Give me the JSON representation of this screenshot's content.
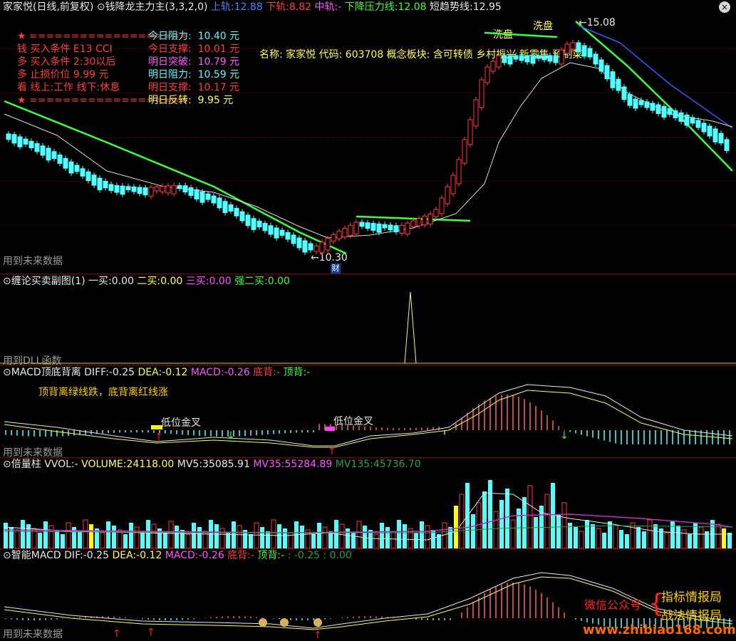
{
  "title_bar": {
    "stock": "家家悦",
    "period": "(日线,前复权)",
    "indicator_icon": "chevron-circle-icon",
    "indicator": "钱降龙主力主(3,3,2,0)",
    "up_track_label": "上轨:",
    "up_track_value": "12.88",
    "down_track_label": "下轨:",
    "down_track_value": "8.82",
    "mid_track_label": "中轨:",
    "mid_track_value": "-",
    "pressure_label": "下降压力线:",
    "pressure_value": "12.08",
    "short_trend_label": "短趋势线:",
    "short_trend_value": "12.95",
    "close_icon": "x-circle-icon",
    "close_glyph": "×"
  },
  "info_left": [
    {
      "star": "★",
      "text": "===================",
      "color": "#ff3c3c"
    },
    {
      "char": "钱",
      "text": "买入条件 E13 CCI",
      "color": "#ff3c3c"
    },
    {
      "char": "多",
      "text": "买入条件 2:30以后",
      "color": "#ff3c3c"
    },
    {
      "char": "多",
      "text": "止损价位 9.99 元",
      "color": "#ff3c3c"
    },
    {
      "char": "看",
      "text": "线上:工作 线下:休息",
      "color": "#ff3c3c"
    },
    {
      "star": "★",
      "text": "===================",
      "color": "#ff3c3c"
    }
  ],
  "info_right": [
    {
      "label": "今日阻力:",
      "value": "10.40 元",
      "label_color": "#54ffff",
      "value_color": "#54ffff"
    },
    {
      "label": "今日支撑:",
      "value": "10.01 元",
      "label_color": "#ff3c3c",
      "value_color": "#ff3c3c"
    },
    {
      "label": "明日突破:",
      "value": "10.79 元",
      "label_color": "#ff54ff",
      "value_color": "#ff54ff"
    },
    {
      "label": "明日阻力:",
      "value": "10.59 元",
      "label_color": "#54ffff",
      "value_color": "#54ffff"
    },
    {
      "label": "明日支撑:",
      "value": "10.17 元",
      "label_color": "#ff3c3c",
      "value_color": "#ff3c3c"
    },
    {
      "label": "明日反转:",
      "value": "9.95 元",
      "label_color": "#ffff54",
      "value_color": "#ffff54"
    }
  ],
  "stock_info": "名称: 家家悦 代码: 603708 概念板块: 含可转债 乡村振兴 新零售 预制菜",
  "price_annotations": {
    "wash1": "洗盘",
    "wash2": "洗盘",
    "high": "15.08",
    "low": "10.30",
    "cai_badge": "财",
    "future_data_1": "用到未来数据"
  },
  "panel2": {
    "icon": "chevron-circle-icon",
    "title": "缠论买卖副图(1)",
    "buy1_label": "一买:",
    "buy1_value": "0.00",
    "buy2_label": "二买:",
    "buy2_value": "0.00",
    "buy3_label": "三买:",
    "buy3_value": "0.00",
    "strong_label": "强二买:",
    "strong_value": "0.00",
    "footer": "用到DLL函数"
  },
  "panel3": {
    "icon": "chevron-circle-icon",
    "title": "MACD顶底背离",
    "diff_label": "DIFF:",
    "diff_value": "-0.25",
    "dea_label": "DEA:",
    "dea_value": "-0.12",
    "macd_label": "MACD:",
    "macd_value": "-0.26",
    "bottom_label": "底背:",
    "bottom_value": "-",
    "top_label": "顶背:",
    "top_value": "-",
    "note": "顶背离绿线跌，底背离红线涨",
    "cross1": "低位金叉",
    "cross2": "低位金叉",
    "footer": "用到未来数据"
  },
  "panel4": {
    "icon": "chevron-circle-icon",
    "title": "倍量柱",
    "vvol_label": "VVOL:",
    "vvol_value": "-",
    "volume_label": "VOLUME:",
    "volume_value": "24118.00",
    "mv5_label": "MV5:",
    "mv5_value": "35085.91",
    "mv35_label": "MV35:",
    "mv35_value": "55284.89",
    "mv135_label": "MV135:",
    "mv135_value": "45736.70"
  },
  "panel5": {
    "icon": "chevron-circle-icon",
    "title": "智能MACD",
    "dif_label": "DIF:",
    "dif_value": "-0.25",
    "dea_label": "DEA:",
    "dea_value": "-0.12",
    "macd_label": "MACD:",
    "macd_value": "-0.26",
    "bottom_label": "底背:",
    "bottom_value": "-",
    "top_label": "顶背:",
    "top_value": "-",
    "extra": ": -0.25 : 0.00",
    "footer": "用到未来数据"
  },
  "watermark": {
    "wechat": "微信公众号",
    "line1": "指标情报局",
    "line2": "战法情报局",
    "site": "www.zhibiao168.com"
  },
  "colors": {
    "bg": "#000000",
    "up": "#ff3c3c",
    "down": "#54ffff",
    "pressure": "#3cff3c",
    "blue_line": "#3a55ff",
    "white_line": "#d8d8d8",
    "border": "#8b0000"
  }
}
